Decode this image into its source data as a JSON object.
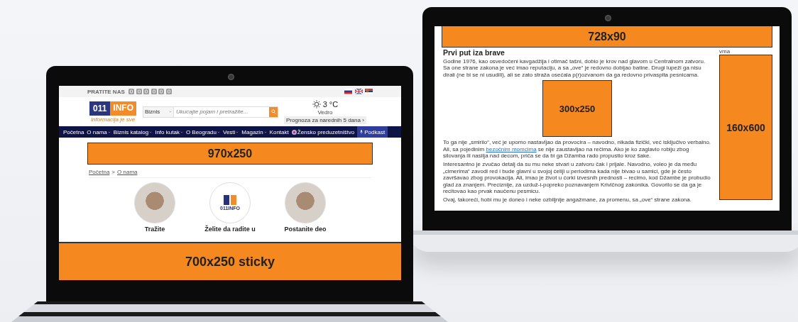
{
  "left_laptop": {
    "topbar": {
      "follow_label": "PRATITE NAS"
    },
    "logo": {
      "number": "011",
      "name": "INFO",
      "tagline": "Informacija je sve"
    },
    "search": {
      "category": "Biznis",
      "placeholder": "Ukucajte pojam i pretražite..."
    },
    "weather": {
      "temperature": "3 °C",
      "condition": "Vedro",
      "forecast_link": "Prognoza za narednih 5 dana ›"
    },
    "nav": [
      {
        "label": "Početna",
        "kind": "link",
        "dropdown": false
      },
      {
        "label": "O nama",
        "kind": "link",
        "dropdown": true
      },
      {
        "label": "Biznis katalog",
        "kind": "link",
        "dropdown": true
      },
      {
        "label": "Info kutak",
        "kind": "link",
        "dropdown": true
      },
      {
        "label": "O Beogradu",
        "kind": "link",
        "dropdown": true
      },
      {
        "label": "Vesti",
        "kind": "link",
        "dropdown": true
      },
      {
        "label": "Magazin",
        "kind": "link",
        "dropdown": true
      },
      {
        "label": "Kontakt",
        "kind": "link",
        "dropdown": false
      },
      {
        "label": "Žensko preduzetništvo",
        "kind": "icon-link",
        "dropdown": false
      },
      {
        "label": "Podkast",
        "kind": "highlight",
        "dropdown": false
      }
    ],
    "ad_banner": "970x250",
    "breadcrumbs": {
      "items": [
        "Početna",
        "O nama"
      ],
      "separator": ">"
    },
    "cards": [
      {
        "kind": "photo",
        "caption": "Tražite"
      },
      {
        "kind": "logo",
        "logo_text": "011INFO",
        "caption": "Želite da radite u"
      },
      {
        "kind": "photo",
        "caption": "Postanite deo"
      }
    ],
    "sticky_ad": "700x250 sticky"
  },
  "right_laptop": {
    "top_ad": "728x90",
    "heading": "Prvi put iza brave",
    "paragraphs": [
      [
        {
          "kind": "text",
          "text": "Godine 1976, kao osvedočeni kavgadžija i otimač tašni, dobio je krov nad glavom u Centralnom zatvoru. Sa one strane zakona je već imao reputaciju, a sa „ove“ je redovno dobijao batine. Drugi lupeži ga nisu dirali (ne bi se ni usudili), ali se zato straža osećala p(r)ozvanom da ga redovno privaspita pesnicama."
        }
      ],
      [
        {
          "kind": "text",
          "text": "To ga nije „smirilo“, već je upomo nastavljao da provocira – navodno, nikada fizički, već isključivo verbalno. Ali, sa pojedinim "
        },
        {
          "kind": "link",
          "text": "bezočnim momcima"
        },
        {
          "kind": "text",
          "text": " se nije zaustavljao na rečima. Ako je ko zaglavio robiju zbog silovanja ili nasilja nad decom, priča se da bi ga Džamba rado propustio kroz šake."
        }
      ],
      [
        {
          "kind": "text",
          "text": "Interesantno je zvučao detalj da su mu neke stvari u zatvoru čak i prijale. Navodno, voleo je da među „cimerima“ zavodi red i bude glavni u svojoj ćeliji u periodima kada nije bivao u samici, gde je često završavao zbog provokacija. Ali, imao je život u ćorki izvesnih prednosti – recimo, kod Džambe je probudio glad za znanjem. Preciznije, za uzduž-i-popreko poznavanjem Krivičnog zakonika. Govorilo se da ga je recitovao kao prvak naučenu pesmicu."
        }
      ],
      [
        {
          "kind": "text",
          "text": "Ovaj, takoreći, hobi mu je doneo i neke ozbiljnije angažmane, za promenu, sa „ove“ strane zakona."
        }
      ]
    ],
    "inline_ad": "300x250",
    "sidebar_label": "vma",
    "sidebar_ad": "160x600"
  }
}
